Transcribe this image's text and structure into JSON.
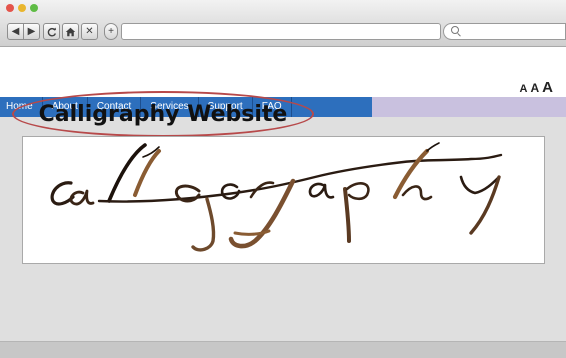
{
  "browser": {
    "buttons": {
      "back": "◀",
      "forward": "▶",
      "reload": "C",
      "home": "⌂",
      "stop": "✕",
      "new_tab": "+"
    },
    "address_value": "",
    "search_value": ""
  },
  "page": {
    "font_size_controls": [
      "A",
      "A",
      "A"
    ],
    "nav": {
      "items": [
        "Home",
        "About",
        "Contact",
        "Services",
        "Support",
        "FAQ"
      ],
      "bar_color": "#2d6fbd",
      "strip_color": "#c9c1df"
    },
    "title": "Calligraphy Website",
    "title_highlight_color": "#b7494a",
    "banner_image": "calligraphy-artwork"
  }
}
